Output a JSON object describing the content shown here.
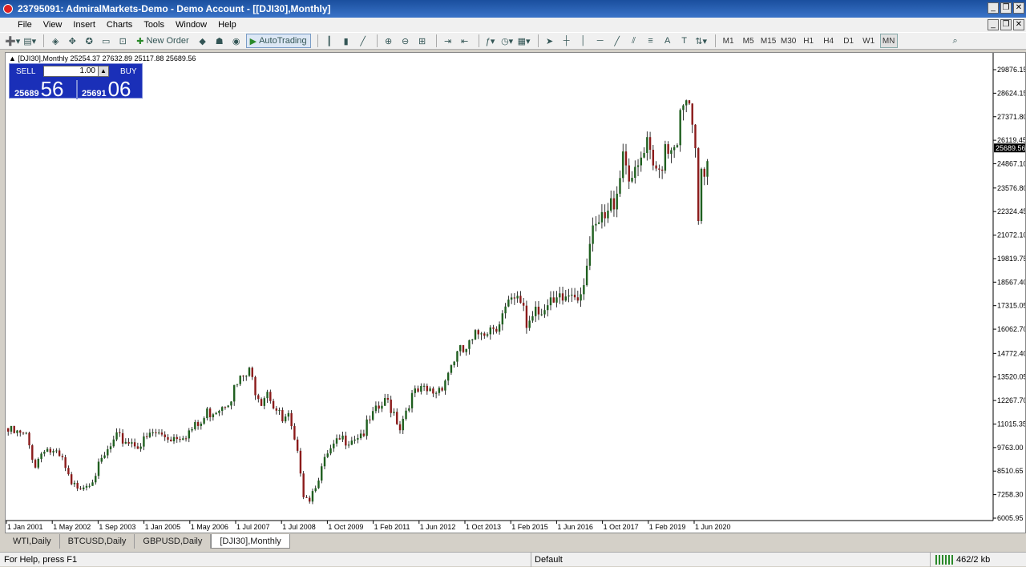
{
  "window": {
    "title": "23795091: AdmiralMarkets-Demo - Demo Account - [[DJI30],Monthly]",
    "minimize": "_",
    "restore": "❐",
    "close": "✕"
  },
  "menu": [
    "File",
    "View",
    "Insert",
    "Charts",
    "Tools",
    "Window",
    "Help"
  ],
  "toolbar": {
    "new_order": "New Order",
    "autotrading": "AutoTrading",
    "timeframes": [
      "M1",
      "M5",
      "M15",
      "M30",
      "H1",
      "H4",
      "D1",
      "W1",
      "MN"
    ],
    "active_timeframe": "MN"
  },
  "chart": {
    "info_line": "[DJI30],Monthly  25254.37 27632.89 25117.88 25689.56",
    "one_click": {
      "sell_label": "SELL",
      "buy_label": "BUY",
      "lot": "1.00",
      "sell_small": "25689",
      "sell_big": "56",
      "buy_small": "25691",
      "buy_big": "06"
    },
    "current_price": "25689.56",
    "price_labels": [
      "29876.15",
      "28624.15",
      "27371.80",
      "26119.45",
      "24867.10",
      "23576.80",
      "22324.45",
      "21072.10",
      "19819.75",
      "18567.40",
      "17315.05",
      "16062.70",
      "14772.40",
      "13520.05",
      "12267.70",
      "11015.35",
      "9763.00",
      "8510.65",
      "7258.30",
      "6005.95"
    ],
    "date_labels": [
      "1 Jan 2001",
      "1 May 2002",
      "1 Sep 2003",
      "1 Jan 2005",
      "1 May 2006",
      "1 Jul 2007",
      "1 Jul 2008",
      "1 Oct 2009",
      "1 Feb 2011",
      "1 Jun 2012",
      "1 Oct 2013",
      "1 Feb 2015",
      "1 Jun 2016",
      "1 Oct 2017",
      "1 Feb 2019",
      "1 Jun 2020"
    ],
    "colors": {
      "up": "#1f5f1f",
      "down": "#8b1a1a",
      "wick": "#000000",
      "price_tag": "#000000"
    }
  },
  "tabs": [
    "WTI,Daily",
    "BTCUSD,Daily",
    "GBPUSD,Daily",
    "[DJI30],Monthly"
  ],
  "active_tab": "[DJI30],Monthly",
  "status": {
    "help": "For Help, press F1",
    "profile": "Default",
    "connection": "462/2 kb"
  }
}
